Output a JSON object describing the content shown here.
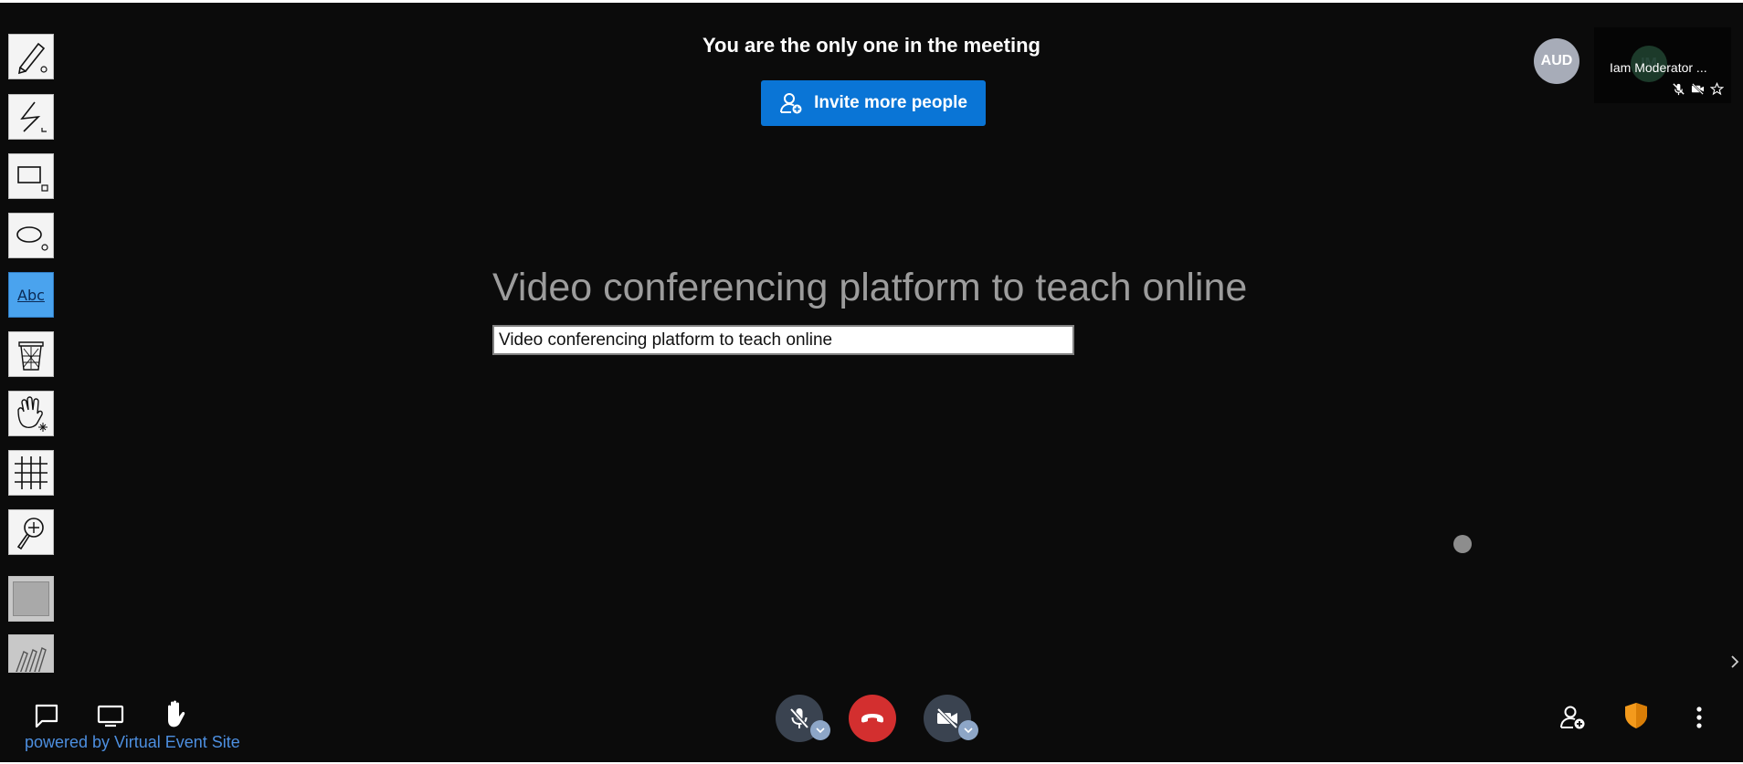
{
  "meeting": {
    "notice": "You are the only one in the meeting",
    "invite_label": "Invite more people"
  },
  "whiteboard": {
    "text": "Video conferencing platform to teach online",
    "input_value": "Video conferencing platform to teach online",
    "abc_label": "Abc",
    "tools": [
      "pencil-icon",
      "polyline-icon",
      "rectangle-icon",
      "ellipse-icon",
      "text-tool-icon",
      "trash-icon",
      "pan-hand-icon",
      "grid-icon",
      "zoom-icon",
      "fill-color",
      "pencils-icon"
    ],
    "active_tool": "text-tool-icon"
  },
  "participants": {
    "audience_badge": "AUD",
    "local_initials": "IM",
    "local_name": "Iam Moderator ..."
  },
  "footer": {
    "powered_by": "powered by Virtual Event Site"
  },
  "colors": {
    "background": "#0b0b0b",
    "accent": "#0a75d6",
    "hangup": "#d32f2f",
    "link": "#4d8fe0"
  }
}
